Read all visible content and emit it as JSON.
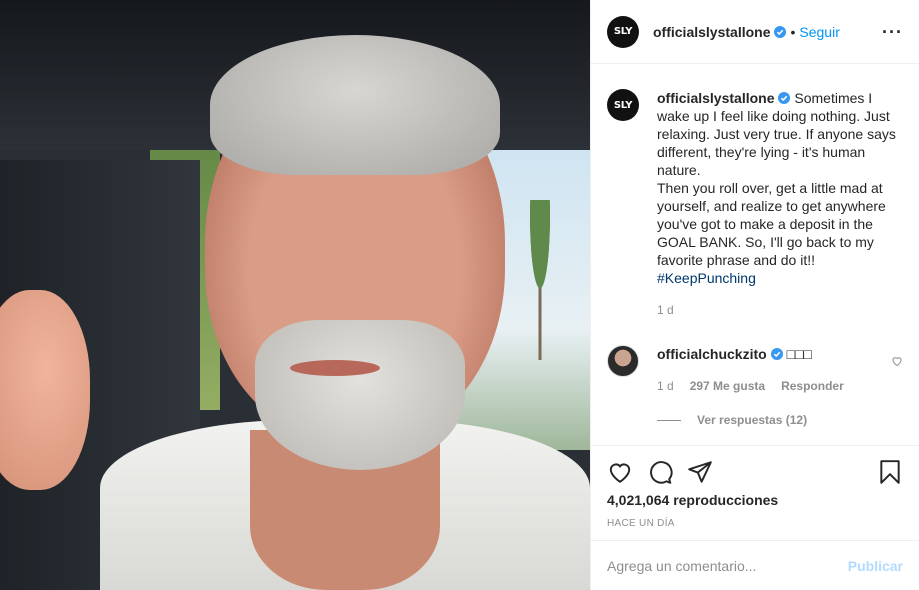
{
  "author": {
    "avatar_text": "SLY",
    "username": "officialslystallone",
    "follow_label": "Seguir"
  },
  "caption": {
    "text": "Sometimes I wake up I feel like doing nothing. Just relaxing. Just very true. If anyone says different, they're lying - it's human nature.\nThen you roll over, get a little mad at yourself, and realize to get anywhere you've got to make a deposit in the GOAL BANK. So, I'll go back to my favorite phrase and do it!!",
    "hashtag": "#KeepPunching",
    "age": "1 d"
  },
  "comment": {
    "username": "officialchuckzito",
    "text": "□□□",
    "age": "1 d",
    "likes": "297 Me gusta",
    "reply_label": "Responder",
    "view_replies": "Ver respuestas (12)"
  },
  "stats": {
    "views_count": "4,021,064",
    "views_label": "reproducciones",
    "posted": "HACE UN DÍA"
  },
  "add_comment": {
    "placeholder": "Agrega un comentario...",
    "publish_label": "Publicar"
  },
  "colors": {
    "link_blue": "#0095f6",
    "hashtag": "#00376b",
    "muted": "#8e8e8e",
    "verified": "#3897f0"
  },
  "icons": [
    "heart-icon",
    "comment-icon",
    "share-icon",
    "bookmark-icon",
    "verified-badge-icon",
    "more-options-icon"
  ]
}
